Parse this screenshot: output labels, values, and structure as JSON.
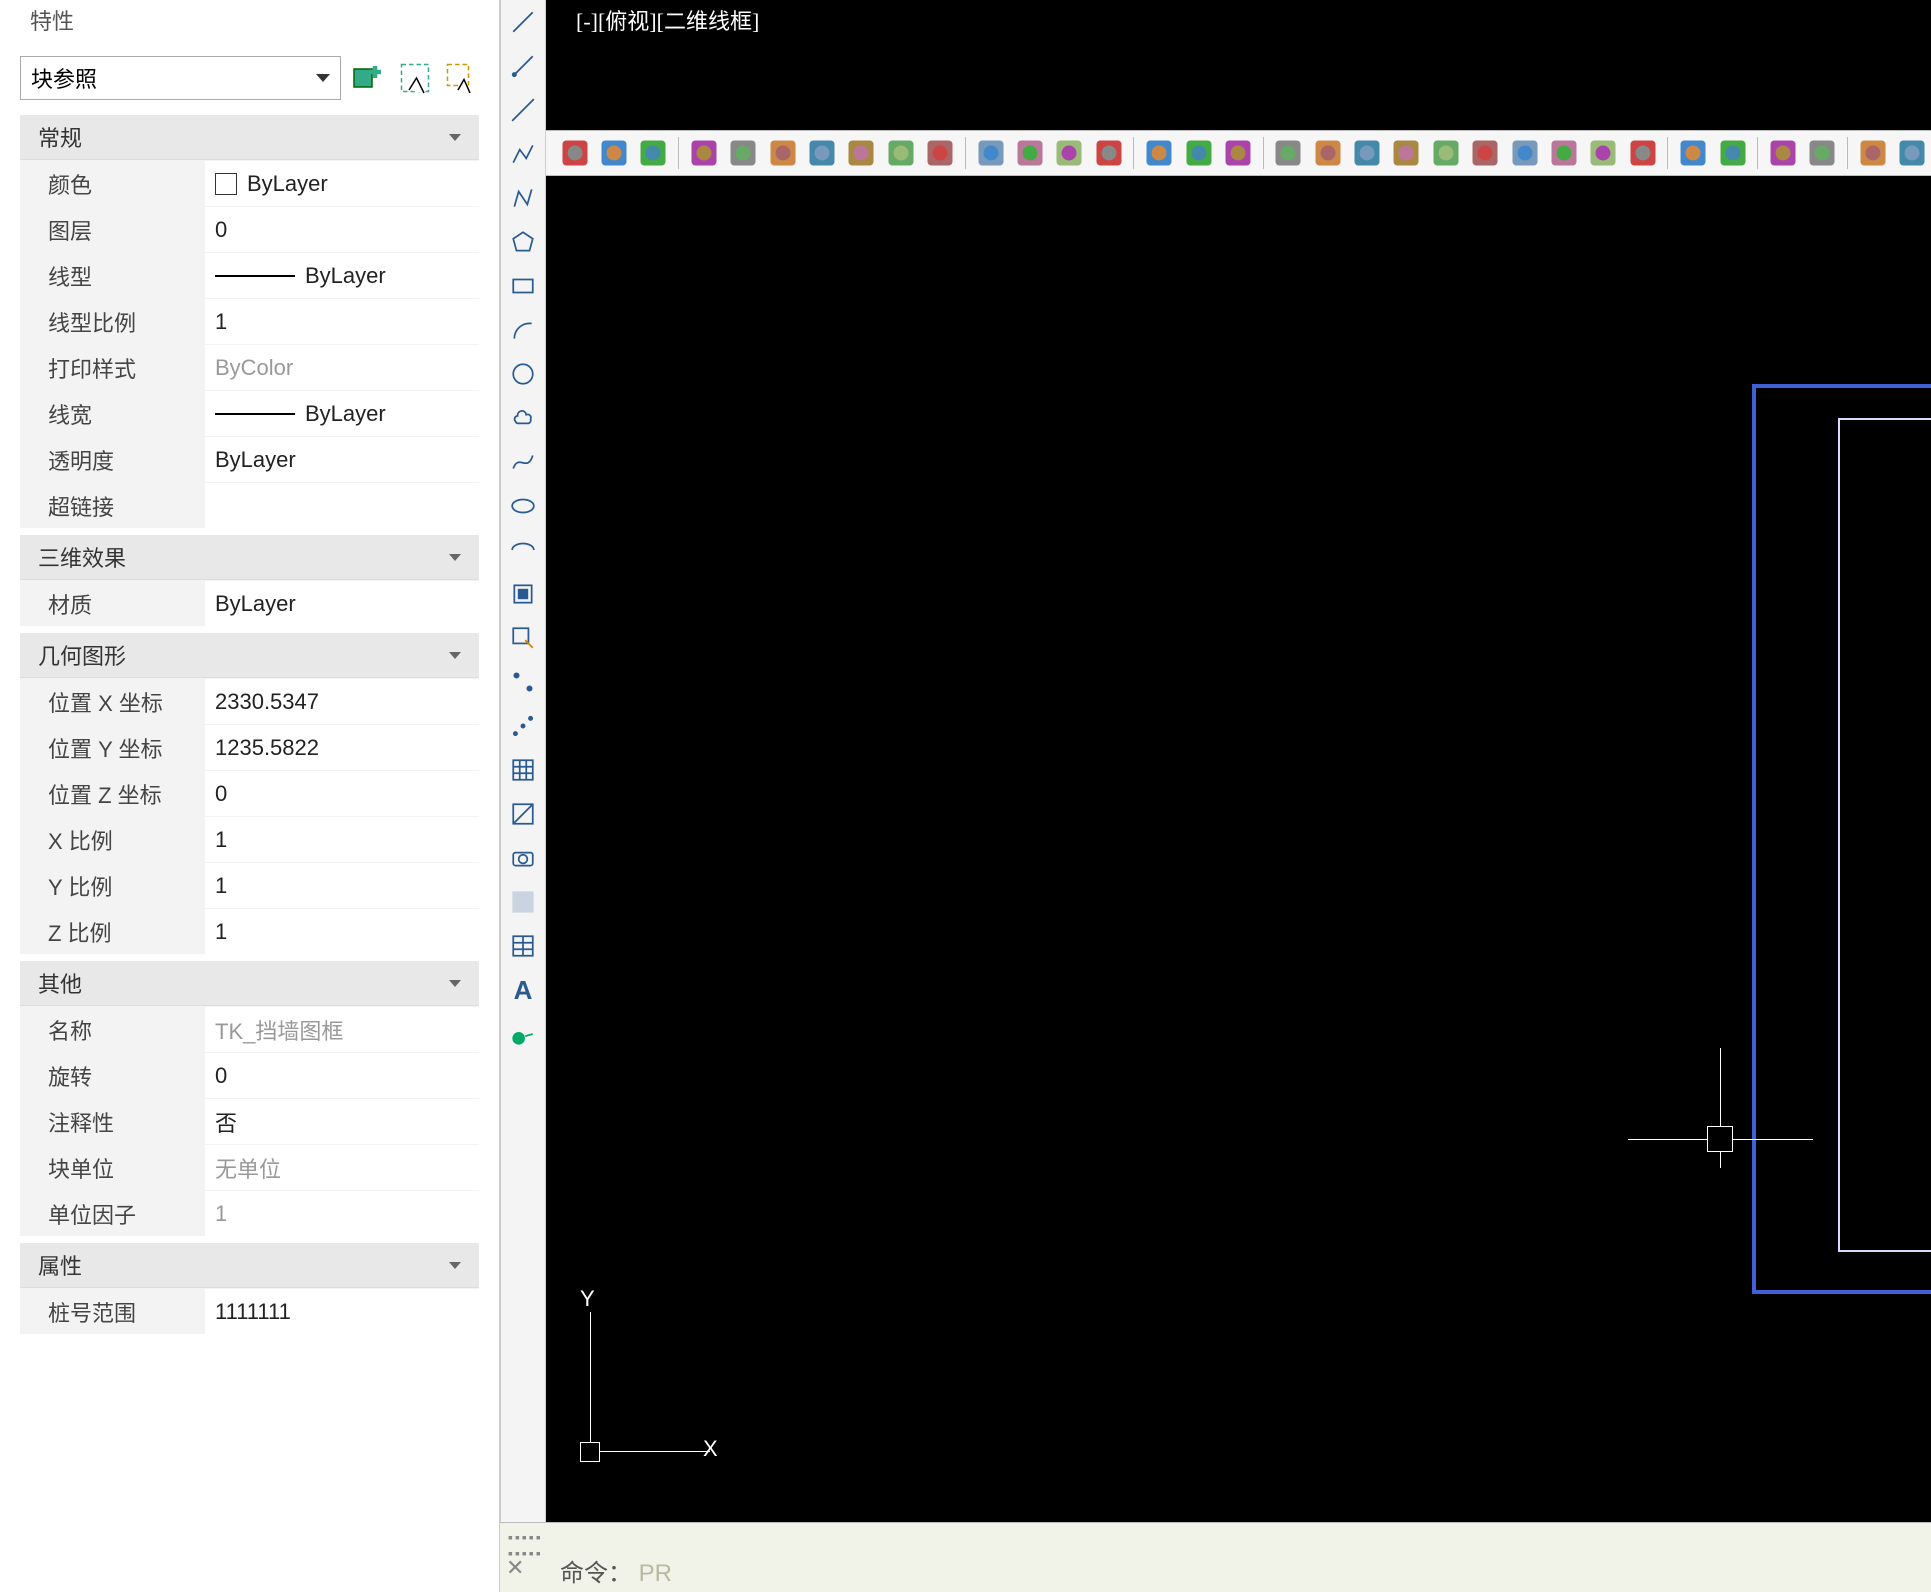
{
  "panel": {
    "title": "特性",
    "object_type": "块参照",
    "sections": [
      {
        "name": "general",
        "label": "常规",
        "rows": [
          {
            "label": "颜色",
            "value": "ByLayer",
            "swatch": true
          },
          {
            "label": "图层",
            "value": "0"
          },
          {
            "label": "线型",
            "value": "ByLayer",
            "line": true
          },
          {
            "label": "线型比例",
            "value": "1"
          },
          {
            "label": "打印样式",
            "value": "ByColor",
            "readonly": true
          },
          {
            "label": "线宽",
            "value": "ByLayer",
            "line": true
          },
          {
            "label": "透明度",
            "value": "ByLayer"
          },
          {
            "label": "超链接",
            "value": ""
          }
        ]
      },
      {
        "name": "effect3d",
        "label": "三维效果",
        "rows": [
          {
            "label": "材质",
            "value": "ByLayer"
          }
        ]
      },
      {
        "name": "geometry",
        "label": "几何图形",
        "rows": [
          {
            "label": "位置 X 坐标",
            "value": "2330.5347"
          },
          {
            "label": "位置 Y 坐标",
            "value": "1235.5822"
          },
          {
            "label": "位置 Z 坐标",
            "value": "0"
          },
          {
            "label": "X 比例",
            "value": "1"
          },
          {
            "label": "Y 比例",
            "value": "1"
          },
          {
            "label": "Z 比例",
            "value": "1"
          }
        ]
      },
      {
        "name": "misc",
        "label": "其他",
        "rows": [
          {
            "label": "名称",
            "value": "TK_挡墙图框",
            "readonly": true
          },
          {
            "label": "旋转",
            "value": "0"
          },
          {
            "label": "注释性",
            "value": "否"
          },
          {
            "label": "块单位",
            "value": "无单位",
            "readonly": true
          },
          {
            "label": "单位因子",
            "value": "1",
            "readonly": true
          }
        ]
      },
      {
        "name": "attrs",
        "label": "属性",
        "rows": [
          {
            "label": "桩号范围",
            "value": "1111111"
          }
        ]
      }
    ]
  },
  "viewport": {
    "label": "[-][俯视][二维线框]"
  },
  "ucs": {
    "x": "X",
    "y": "Y"
  },
  "command": {
    "label": "命令：",
    "value": "PR"
  },
  "toolbar_icons": [
    "line",
    "ray",
    "xline",
    "pline",
    "polygon-3d",
    "rect",
    "arc",
    "arc2",
    "circle",
    "spline",
    "ellipse",
    "ellipse-arc",
    "block",
    "block-edit",
    "point",
    "point-div",
    "hatch",
    "solid",
    "camera",
    "solid3d",
    "table",
    "text",
    "donut"
  ],
  "head_icons": [
    "add-selection-icon",
    "quick-select-icon",
    "pick-icon"
  ],
  "htoolbar": {
    "groups": [
      [
        "image-insert",
        "image-attach",
        "image-clip"
      ],
      [
        "globe-blue",
        "globe-green",
        "globe-red",
        "globe-gray",
        "globe-white",
        "globe-ball",
        "globe-rainbow"
      ],
      [
        "layer-sheet",
        "layer-red",
        "layer-swap",
        "layer-frame"
      ],
      [
        "refresh-left",
        "refresh-right",
        "target"
      ],
      [
        "cube-1",
        "cube-2",
        "cube-3",
        "cube-4",
        "cube-5",
        "cube-6",
        "cube-7",
        "cube-8",
        "wire",
        "color-blob"
      ],
      [
        "grid-a",
        "grid-b"
      ],
      [
        "grid-c",
        "grid-d"
      ],
      [
        "key-a",
        "key-b"
      ]
    ]
  }
}
